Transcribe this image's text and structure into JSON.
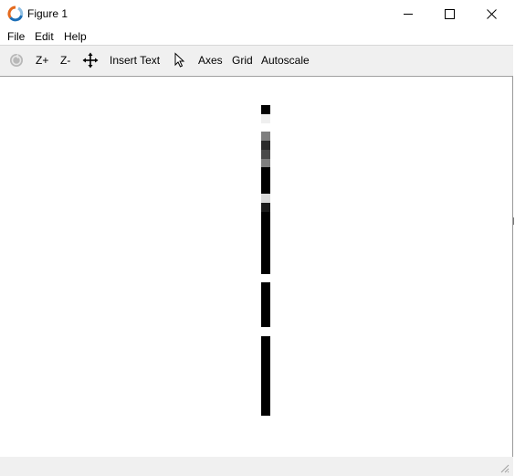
{
  "window": {
    "title": "Figure 1",
    "controls": [
      "minimize-icon",
      "maximize-icon",
      "close-icon"
    ]
  },
  "menubar": {
    "items": [
      {
        "label": "File"
      },
      {
        "label": "Edit"
      },
      {
        "label": "Help"
      }
    ]
  },
  "toolbar": {
    "rotate_icon": "rotate-icon",
    "zoom_in_label": "Z+",
    "zoom_out_label": "Z-",
    "pan_icon": "pan-arrows-icon",
    "insert_text_label": "Insert Text",
    "select_icon": "pointer-arrow-icon",
    "axes_label": "Axes",
    "grid_label": "Grid",
    "autoscale_label": "Autoscale"
  },
  "image": {
    "description_colors": {
      "black": "#000000",
      "white": "#ffffff",
      "light_gray": "#efefef",
      "mid_gray": "#7f7f7f",
      "dark_gray": "#2a2a2a",
      "silver": "#d8d8d8"
    }
  },
  "colors": {
    "titlebar_bg": "#ffffff",
    "toolbar_bg": "#f0f0f0",
    "canvas_bg": "#ffffff",
    "statusbar_bg": "#f0f0f0"
  }
}
